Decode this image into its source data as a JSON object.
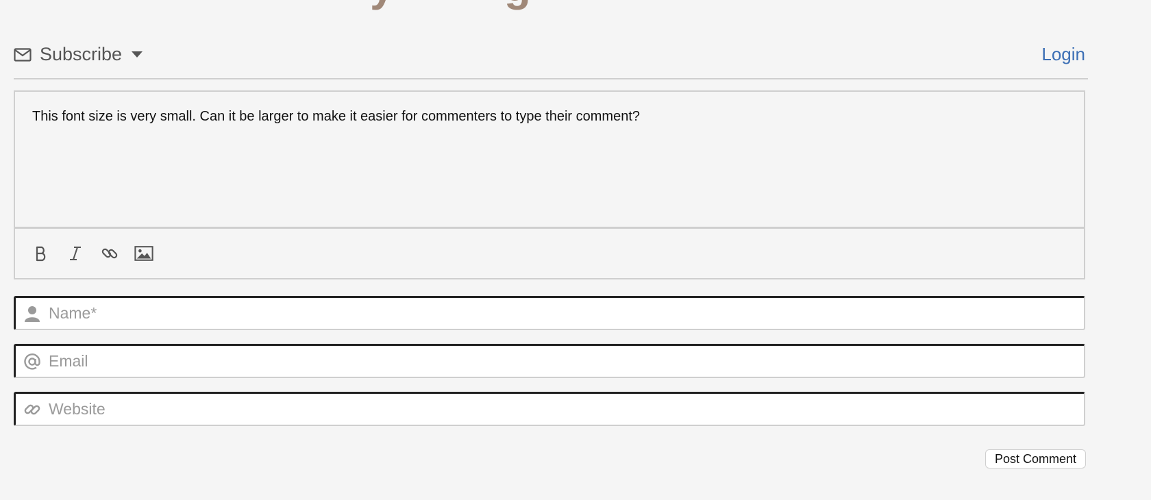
{
  "header": {
    "title_fragment": "y        g"
  },
  "topbar": {
    "subscribe_label": "Subscribe",
    "subscribe_icon": "mail-icon",
    "login_label": "Login",
    "login_color": "#3c6fb5"
  },
  "editor": {
    "text": "This font size is very small. Can it be larger to make it easier for commenters to type their comment?",
    "toolbar": [
      {
        "name": "bold-icon"
      },
      {
        "name": "italic-icon"
      },
      {
        "name": "link-icon"
      },
      {
        "name": "image-icon"
      }
    ]
  },
  "fields": {
    "name": {
      "placeholder": "Name*",
      "value": "",
      "icon": "user-icon"
    },
    "email": {
      "placeholder": "Email",
      "value": "",
      "icon": "at-icon"
    },
    "website": {
      "placeholder": "Website",
      "value": "",
      "icon": "link-icon"
    }
  },
  "actions": {
    "post_label": "Post Comment"
  }
}
